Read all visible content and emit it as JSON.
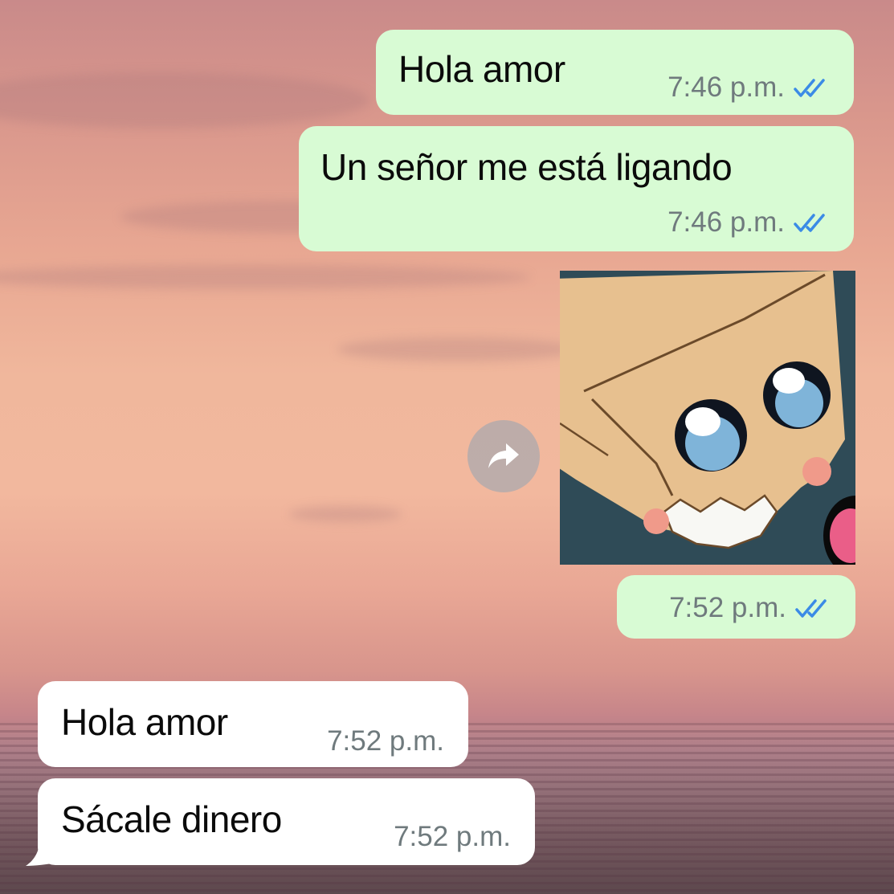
{
  "chat": {
    "messages": [
      {
        "direction": "outgoing",
        "text": "Hola amor",
        "time": "7:46 p.m.",
        "status": "read"
      },
      {
        "direction": "outgoing",
        "text": "Un señor me está ligando",
        "time": "7:46 p.m.",
        "status": "read"
      },
      {
        "direction": "outgoing",
        "type": "image",
        "image_icon": "cartoon-sticker-image",
        "time": "7:52 p.m.",
        "status": "read"
      },
      {
        "direction": "incoming",
        "text": "Hola amor",
        "time": "7:52 p.m."
      },
      {
        "direction": "incoming",
        "text": "Sácale dinero",
        "time": "7:52 p.m."
      }
    ],
    "forward_icon": "forward-arrow-icon",
    "read_icon": "double-check-icon"
  },
  "colors": {
    "outgoing_bubble": "#d8fbd4",
    "incoming_bubble": "#ffffff",
    "read_tick": "#3b8be6",
    "meta_text": "#6f7a7d"
  }
}
